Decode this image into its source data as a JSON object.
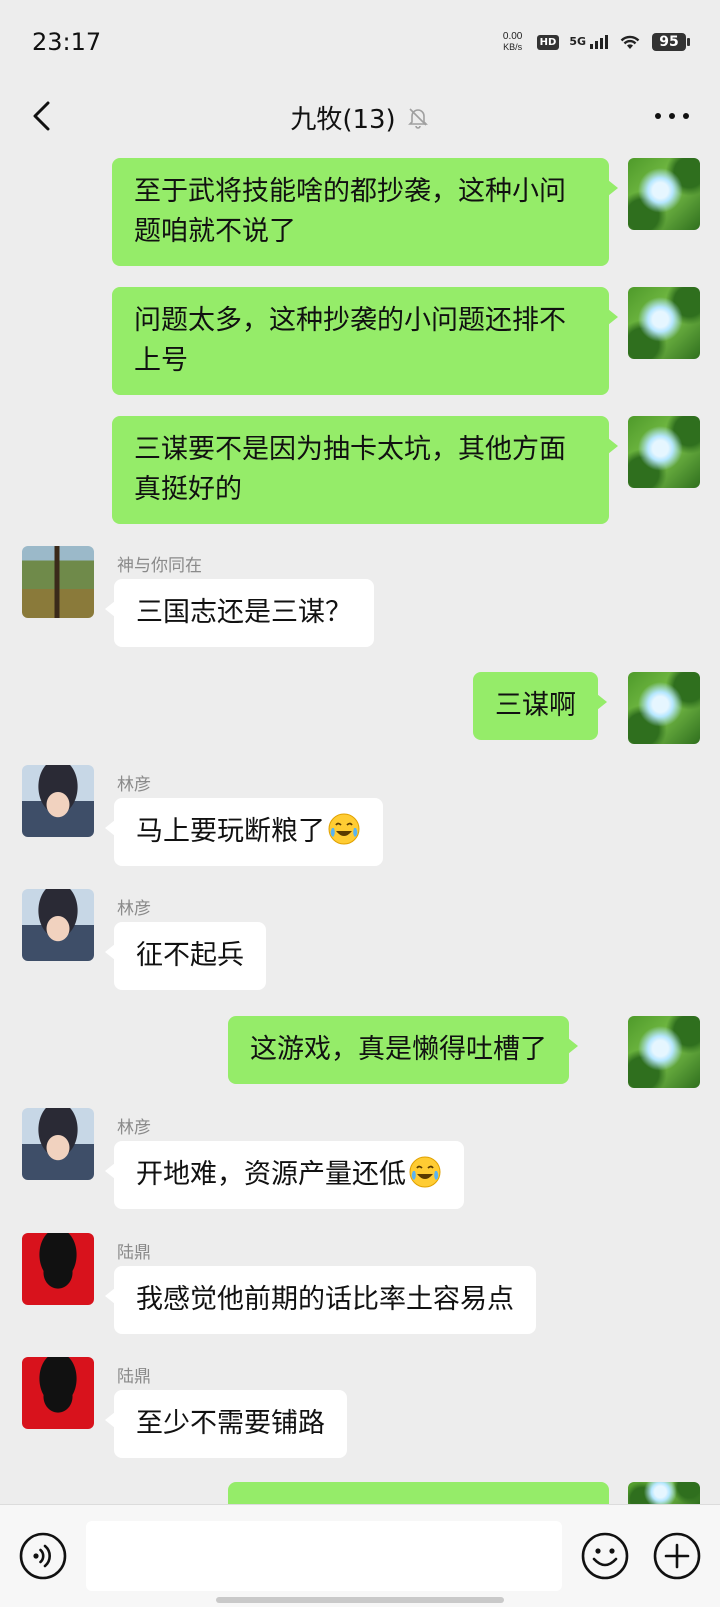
{
  "status_bar": {
    "time": "23:17",
    "net_speed_value": "0.00",
    "net_speed_unit": "KB/s",
    "hd_label": "HD",
    "network_label": "5G",
    "battery_level": "95"
  },
  "header": {
    "title": "九牧(13)",
    "muted_icon": "bell-muted-icon",
    "back_icon": "chevron-left-icon",
    "more_icon": "more-dots-icon"
  },
  "messages": [
    {
      "direction": "out",
      "text": "至于武将技能啥的都抄袭，这种小问题咱就不说了"
    },
    {
      "direction": "out",
      "text": "问题太多，这种抄袭的小问题还排不上号"
    },
    {
      "direction": "out",
      "text": "三谋要不是因为抽卡太坑，其他方面真挺好的"
    },
    {
      "direction": "in",
      "sender": "神与你同在",
      "text": "三国志还是三谋？"
    },
    {
      "direction": "out",
      "text": "三谋啊"
    },
    {
      "direction": "in",
      "sender": "林彦",
      "text": "马上要玩断粮了",
      "emoji": "crying-laugh-emoji"
    },
    {
      "direction": "in",
      "sender": "林彦",
      "text": "征不起兵"
    },
    {
      "direction": "out",
      "text": "这游戏，真是懒得吐槽了"
    },
    {
      "direction": "in",
      "sender": "林彦",
      "text": "开地难，资源产量还低",
      "emoji": "crying-laugh-emoji"
    },
    {
      "direction": "in",
      "sender": "陆鼎",
      "text": "我感觉他前期的话比率土容易点"
    },
    {
      "direction": "in",
      "sender": "陆鼎",
      "text": "至少不需要铺路"
    }
  ],
  "input_bar": {
    "voice_icon": "voice-icon",
    "emoji_icon": "smiley-icon",
    "plus_icon": "plus-icon",
    "message_value": ""
  },
  "colors": {
    "background": "#ededed",
    "outgoing_bubble": "#95ec69",
    "incoming_bubble": "#ffffff",
    "sender_name": "#8a8a8a"
  }
}
